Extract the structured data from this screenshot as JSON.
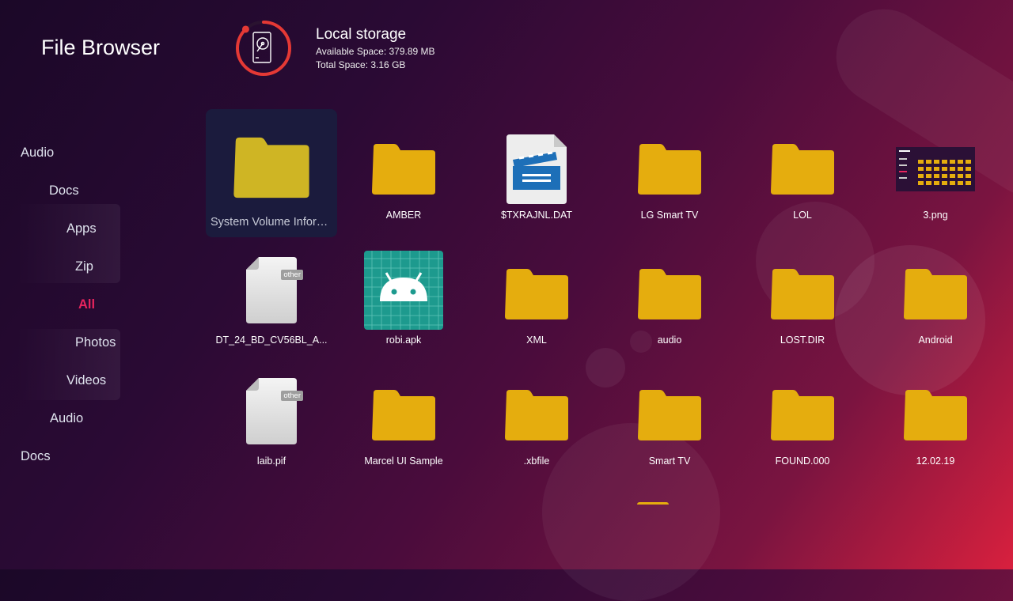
{
  "app": {
    "title": "File Browser"
  },
  "storage": {
    "name": "Local storage",
    "available": "Available Space: 379.89 MB",
    "total": "Total Space: 3.16 GB",
    "used_fraction": 0.88,
    "ring_color": "#e53935",
    "icon": "hard-drive-icon"
  },
  "sidebar": {
    "items": [
      {
        "label": "Audio"
      },
      {
        "label": "Docs"
      },
      {
        "label": "Apps"
      },
      {
        "label": "Zip"
      },
      {
        "label": "All",
        "active": true
      },
      {
        "label": "Photos"
      },
      {
        "label": "Videos"
      },
      {
        "label": "Audio"
      },
      {
        "label": "Docs"
      }
    ]
  },
  "files": [
    {
      "name": "System Volume Inform...",
      "type": "folder",
      "selected": true
    },
    {
      "name": "AMBER",
      "type": "folder"
    },
    {
      "name": "$TXRAJNL.DAT",
      "type": "video"
    },
    {
      "name": "LG Smart TV",
      "type": "folder"
    },
    {
      "name": "LOL",
      "type": "folder"
    },
    {
      "name": "3.png",
      "type": "image"
    },
    {
      "name": "DT_24_BD_CV56BL_A...",
      "type": "other",
      "badge": "other"
    },
    {
      "name": "robi.apk",
      "type": "apk"
    },
    {
      "name": "XML",
      "type": "folder"
    },
    {
      "name": "audio",
      "type": "folder"
    },
    {
      "name": "LOST.DIR",
      "type": "folder"
    },
    {
      "name": "Android",
      "type": "folder"
    },
    {
      "name": "laib.pif",
      "type": "other",
      "badge": "other"
    },
    {
      "name": "Marcel UI Sample",
      "type": "folder"
    },
    {
      "name": ".xbfile",
      "type": "folder"
    },
    {
      "name": "Smart TV",
      "type": "folder"
    },
    {
      "name": "FOUND.000",
      "type": "folder"
    },
    {
      "name": "12.02.19",
      "type": "folder"
    }
  ],
  "colors": {
    "folder": "#e5ad0e",
    "folder_selected": "#cfb524",
    "accent": "#e8245e",
    "apk_bg": "#1d9a8e"
  }
}
